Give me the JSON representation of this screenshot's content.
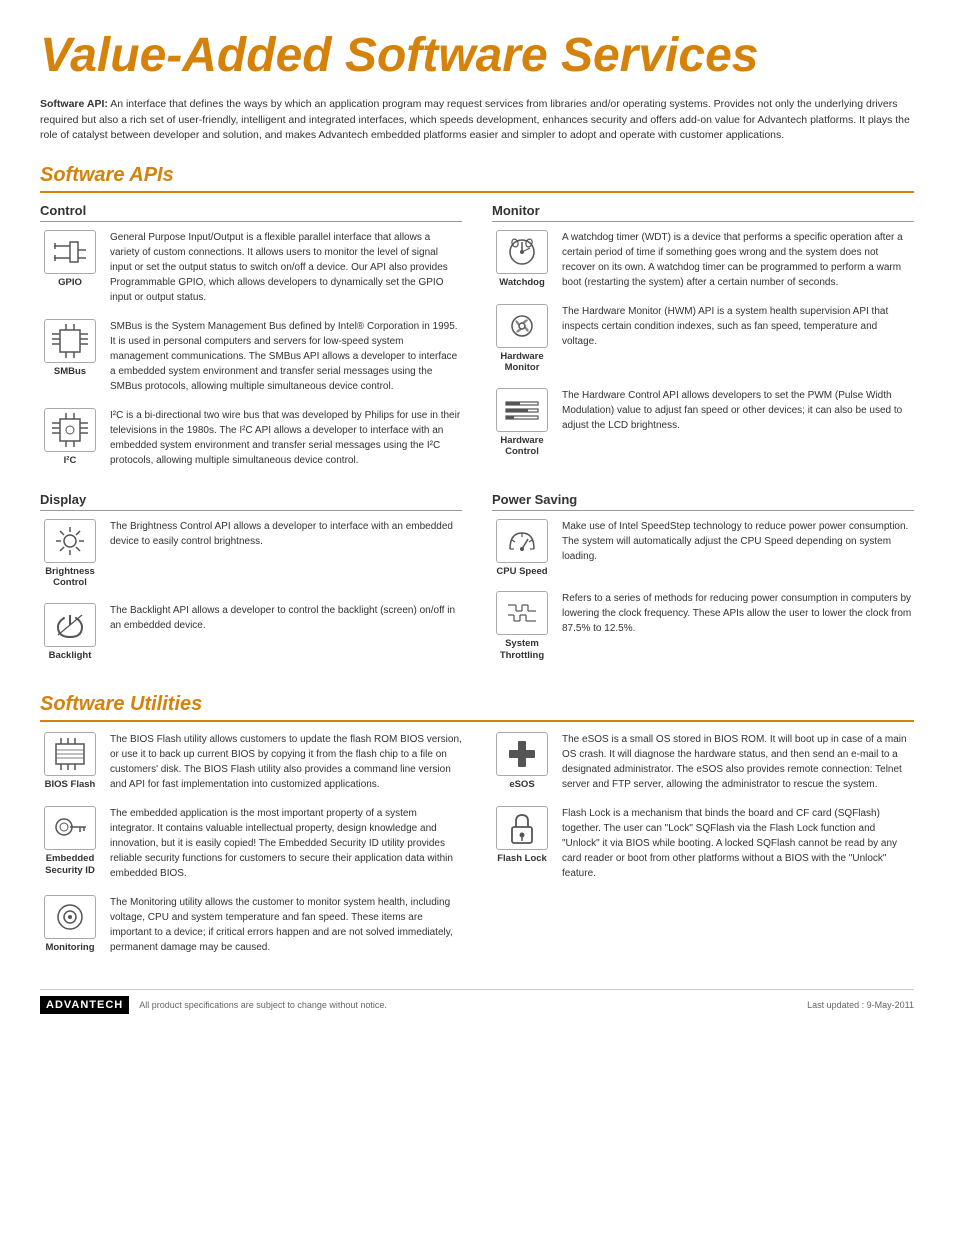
{
  "page": {
    "title": "Value-Added Software Services",
    "intro_label": "Software API:",
    "intro_text": "An interface that defines the ways by which an application program may request services from libraries and/or operating systems. Provides not only the underlying drivers required but also a rich set of user-friendly, intelligent and integrated interfaces, which speeds development, enhances security and offers add-on value for Advantech platforms. It plays the role of catalyst between developer and solution, and makes Advantech embedded platforms easier and simpler to adopt and operate with customer applications.",
    "section_apis": "Software APIs",
    "section_utilities": "Software Utilities",
    "col_control": "Control",
    "col_monitor": "Monitor",
    "col_display": "Display",
    "col_power": "Power Saving",
    "footer_left": "All product specifications are subject to change without notice.",
    "footer_right": "Last updated : 9-May-2011",
    "logo": "ADVANTECH"
  },
  "control_items": [
    {
      "label": "GPIO",
      "text": "General Purpose Input/Output is a flexible parallel interface that allows a variety of custom connections. It allows users to monitor the level of signal input or set the output status to switch on/off a device. Our API also provides Programmable GPIO, which allows developers to dynamically set the GPIO input or output status."
    },
    {
      "label": "SMBus",
      "text": "SMBus is the System Management Bus defined by Intel® Corporation in 1995. It is used in personal computers and servers for low-speed system management communications. The SMBus API allows a developer to interface a embedded system environment and transfer serial messages using the SMBus protocols, allowing multiple simultaneous device control."
    },
    {
      "label": "I²C",
      "text": "I²C is a bi-directional two wire bus that was developed by Philips for use in their televisions in the 1980s. The I²C API allows a developer to interface with an embedded system environment and transfer serial messages using the I²C protocols, allowing multiple simultaneous device control."
    }
  ],
  "monitor_items": [
    {
      "label": "Watchdog",
      "text": "A watchdog timer (WDT) is a device that performs a specific operation after a certain period of time if something goes wrong and the system does not recover on its own. A watchdog timer can be programmed to perform a warm boot (restarting the system) after a certain number of seconds."
    },
    {
      "label": "Hardware\nMonitor",
      "text": "The Hardware Monitor (HWM) API is a system health supervision API that inspects certain condition indexes, such as fan speed, temperature and voltage."
    },
    {
      "label": "Hardware\nControl",
      "text": "The Hardware Control API allows developers to set the PWM (Pulse Width Modulation) value to adjust fan speed or other devices; it can also be used to adjust the LCD brightness."
    }
  ],
  "display_items": [
    {
      "label": "Brightness\nControl",
      "text": "The Brightness Control API allows a developer to interface with an embedded device to easily control brightness."
    },
    {
      "label": "Backlight",
      "text": "The Backlight API allows a developer to control the backlight (screen) on/off in an embedded device."
    }
  ],
  "power_items": [
    {
      "label": "CPU Speed",
      "text": "Make use of Intel SpeedStep technology to reduce power power consumption. The system will automatically adjust the CPU Speed depending on system loading."
    },
    {
      "label": "System\nThrottling",
      "text": "Refers to a series of methods for reducing power consumption in computers by lowering the clock frequency. These APIs allow the user to lower the clock from 87.5% to 12.5%."
    }
  ],
  "utility_left": [
    {
      "label": "BIOS Flash",
      "text": "The BIOS Flash utility allows customers to update the flash ROM BIOS version, or use it to back up current BIOS by copying it from the flash chip to a file on customers' disk. The BIOS Flash utility also provides a command line version and API for fast implementation into customized applications."
    },
    {
      "label": "Embedded\nSecurity ID",
      "text": "The embedded application is the most important property of a system integrator. It contains valuable intellectual property, design knowledge and innovation, but it is easily copied! The Embedded Security ID utility provides reliable security functions for customers to secure their application data within embedded BIOS."
    },
    {
      "label": "Monitoring",
      "text": "The Monitoring utility allows the customer to monitor system health, including voltage, CPU and system temperature and fan speed. These items are important to a device; if critical errors happen and are not solved immediately, permanent damage may be caused."
    }
  ],
  "utility_right": [
    {
      "label": "eSOS",
      "text": "The eSOS is a small OS stored in BIOS ROM. It will boot up in case of a main OS crash. It will diagnose the hardware status, and then send an e-mail to a designated administrator. The eSOS also provides remote connection: Telnet server and FTP server, allowing the administrator to rescue the system."
    },
    {
      "label": "Flash Lock",
      "text": "Flash Lock is a mechanism that binds the board and CF card (SQFlash) together. The user can \"Lock\" SQFlash via the Flash Lock function and \"Unlock\" it via BIOS while booting. A locked SQFlash cannot be read by any card reader or boot from other platforms without a BIOS with the \"Unlock\" feature."
    }
  ]
}
